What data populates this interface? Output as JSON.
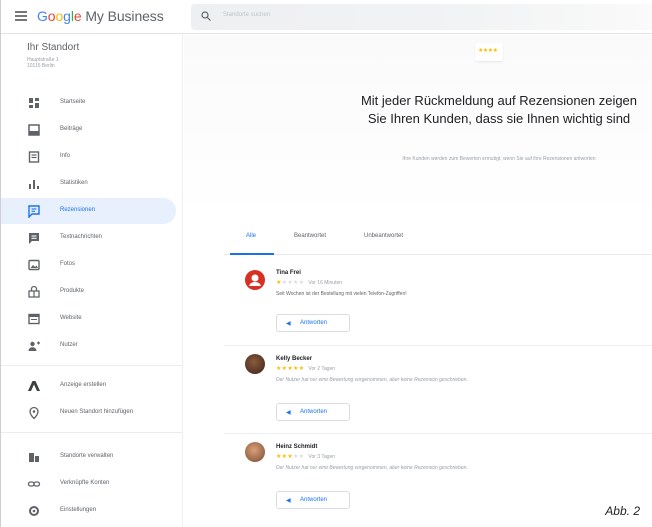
{
  "header": {
    "brand_google": [
      "G",
      "o",
      "o",
      "g",
      "l",
      "e"
    ],
    "brand_rest": " My Business",
    "search_placeholder": "Standorte suchen"
  },
  "sidebar": {
    "location_title": "Ihr Standort",
    "location_address_line1": "Hauptstraße 1",
    "location_address_line2": "10115 Berlin",
    "items": [
      {
        "label": "Startseite",
        "icon": "dashboard-icon"
      },
      {
        "label": "Beiträge",
        "icon": "posts-icon"
      },
      {
        "label": "Info",
        "icon": "info-icon"
      },
      {
        "label": "Statistiken",
        "icon": "insights-icon"
      },
      {
        "label": "Rezensionen",
        "icon": "reviews-icon",
        "active": true
      },
      {
        "label": "Textnachrichten",
        "icon": "messages-icon"
      },
      {
        "label": "Fotos",
        "icon": "photos-icon"
      },
      {
        "label": "Produkte",
        "icon": "products-icon"
      },
      {
        "label": "Website",
        "icon": "website-icon"
      },
      {
        "label": "Nutzer",
        "icon": "users-icon"
      }
    ],
    "items_lower": [
      {
        "label": "Anzeige erstellen",
        "icon": "ads-icon"
      },
      {
        "label": "Neuen Standort hinzufügen",
        "icon": "add-location-icon"
      }
    ],
    "items_bottom": [
      {
        "label": "Standorte verwalten",
        "icon": "manage-locations-icon"
      },
      {
        "label": "Verknüpfte Konten",
        "icon": "linked-accounts-icon"
      },
      {
        "label": "Einstellungen",
        "icon": "settings-icon"
      }
    ]
  },
  "hero": {
    "badge_stars": "★★★★",
    "title": "Mit jeder Rückmeldung auf Rezensionen zeigen Sie Ihren Kunden, dass sie Ihnen wichtig sind",
    "subtitle": "Ihre Kunden werden zum Bewerten ermutigt, wenn Sie auf ihre Rezensionen antworten"
  },
  "tabs": [
    {
      "label": "Alle",
      "active": true
    },
    {
      "label": "Beantwortet"
    },
    {
      "label": "Unbeantwortet"
    }
  ],
  "reviews": [
    {
      "name": "Tina Frei",
      "rating": 1,
      "time": "Vor 16 Minuten",
      "text": "Seit Wochen ist der Bestellung mit vielen Telefon-Zugriffen!",
      "italic": false,
      "avatar_color": "#d93025",
      "reply_label": "Antworten"
    },
    {
      "name": "Kelly Becker",
      "rating": 5,
      "time": "Vor 2 Tagen",
      "text": "Der Nutzer hat nur eine Bewertung vorgenommen, aber keine Rezension geschrieben.",
      "italic": true,
      "avatar_color": "#5b3a29",
      "reply_label": "Antworten"
    },
    {
      "name": "Heinz Schmidt",
      "rating": 3,
      "time": "Vor 3 Tagen",
      "text": "Der Nutzer hat nur eine Bewertung vorgenommen, aber keine Rezension geschrieben.",
      "italic": true,
      "avatar_color": "#a0704c",
      "reply_label": "Antworten"
    }
  ],
  "caption": "Abb. 2",
  "colors": {
    "accent": "#1a73e8",
    "star": "#fbbc04",
    "active_nav_bg": "#e8f0fe"
  }
}
